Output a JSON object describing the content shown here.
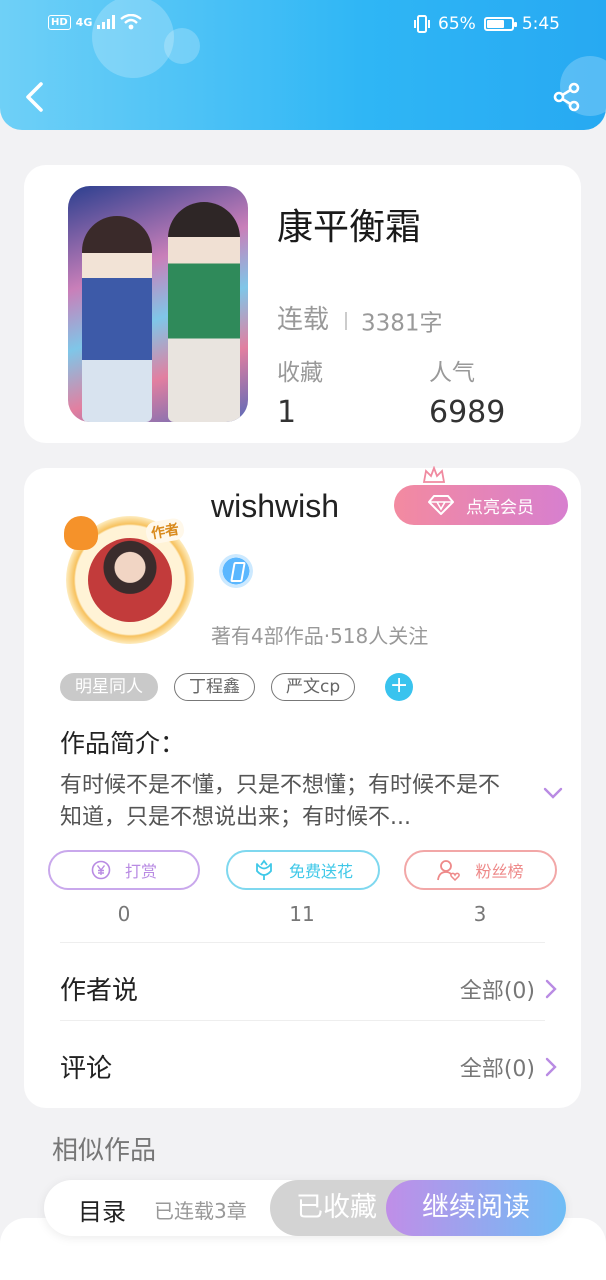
{
  "status_bar": {
    "left_label": "HD",
    "network": "4G",
    "battery_percent": "65%",
    "battery_level": 0.65,
    "time": "5:45"
  },
  "header": {
    "back_icon": "chevron-left-icon",
    "share_icon": "share-icon"
  },
  "book": {
    "title": "康平衡霜",
    "status": "连载",
    "word_count": "3381字",
    "favorites_label": "收藏",
    "favorites_value": "1",
    "popularity_label": "人气",
    "popularity_value": "6989"
  },
  "author": {
    "name": "wishwish",
    "avatar_tag": "作者",
    "vip_button": "点亮会员",
    "stats": "著有4部作品·518人关注"
  },
  "tags": [
    "明星同人",
    "丁程鑫",
    "严文cp"
  ],
  "intro": {
    "title": "作品简介：",
    "text": "有时候不是不懂，只是不想懂；有时候不是不知道，只是不想说出来；有时候不..."
  },
  "actions": [
    {
      "label": "打赏",
      "count": "0",
      "icon": "yen-icon",
      "color": "#b98be3"
    },
    {
      "label": "免费送花",
      "count": "11",
      "icon": "flower-icon",
      "color": "#3fc8e8"
    },
    {
      "label": "粉丝榜",
      "count": "3",
      "icon": "fans-icon",
      "color": "#ee8a8a"
    }
  ],
  "author_says": {
    "label": "作者说",
    "right": "全部(0)"
  },
  "comments": {
    "label": "评论",
    "right": "全部(0)"
  },
  "similar_title": "相似作品",
  "bottom_bar": {
    "toc": "目录",
    "chapters": "已连载3章",
    "saved": "已收藏",
    "continue": "继续阅读"
  },
  "colors": {
    "header_start": "#6fd0f7",
    "header_end": "#27a9f2",
    "accent_purple": "#b98be3"
  }
}
